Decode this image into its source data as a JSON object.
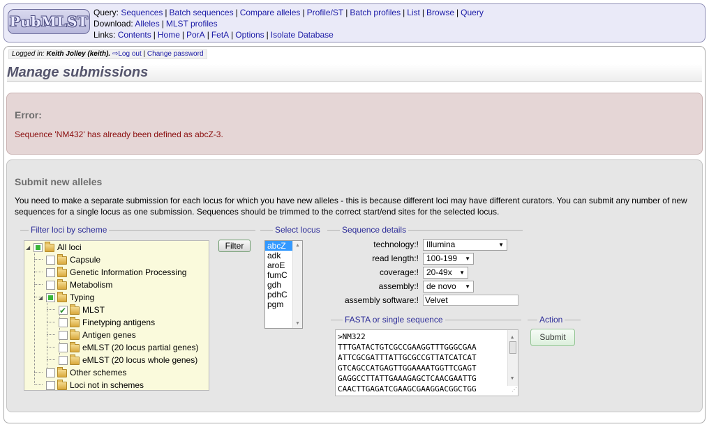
{
  "logo": {
    "text": "PubMLST"
  },
  "nav": {
    "query_label": "Query:",
    "query_links": [
      "Sequences",
      "Batch sequences",
      "Compare alleles",
      "Profile/ST",
      "Batch profiles",
      "List",
      "Browse",
      "Query"
    ],
    "download_label": "Download:",
    "download_links": [
      "Alleles",
      "MLST profiles"
    ],
    "links_label": "Links:",
    "links_links": [
      "Contents",
      "Home",
      "PorA",
      "FetA",
      "Options",
      "Isolate Database"
    ]
  },
  "login": {
    "logged_in_label": "Logged in:",
    "user": "Keith Jolley (keith).",
    "logout": "Log out",
    "separator": "|",
    "change_password": "Change password"
  },
  "page_title": "Manage submissions",
  "error": {
    "title": "Error:",
    "message": "Sequence 'NM432' has already been defined as abcZ-3."
  },
  "submit": {
    "title": "Submit new alleles",
    "intro": "You need to make a separate submission for each locus for which you have new alleles - this is because different loci may have different curators. You can submit any number of new sequences for a single locus as one submission. Sequences should be trimmed to the correct start/end sites for the selected locus.",
    "filter_legend": "Filter loci by scheme",
    "filter_button": "Filter",
    "tree": {
      "all_loci": "All loci",
      "capsule": "Capsule",
      "genetic": "Genetic Information Processing",
      "metabolism": "Metabolism",
      "typing": "Typing",
      "mlst": "MLST",
      "finetyping": "Finetyping antigens",
      "antigen": "Antigen genes",
      "emlst_partial": "eMLST (20 locus partial genes)",
      "emlst_whole": "eMLST (20 locus whole genes)",
      "other": "Other schemes",
      "not_in": "Loci not in schemes"
    },
    "locus_legend": "Select locus",
    "loci": [
      "abcZ",
      "adk",
      "aroE",
      "fumC",
      "gdh",
      "pdhC",
      "pgm"
    ],
    "selected_locus": "abcZ",
    "details_legend": "Sequence details",
    "details": {
      "technology_label": "technology:!",
      "technology_value": "Illumina",
      "read_length_label": "read length:!",
      "read_length_value": "100-199",
      "coverage_label": "coverage:!",
      "coverage_value": "20-49x",
      "assembly_label": "assembly:!",
      "assembly_value": "de novo",
      "software_label": "assembly software:!",
      "software_value": "Velvet"
    },
    "fasta_legend": "FASTA or single sequence",
    "fasta_lines": [
      ">NM322",
      "TTTGATACTGTCGCCGAAGGTTTGGGCGAA",
      "ATTCGCGATTTATTGCGCCGTTATCATCAT",
      "GTCAGCCATGAGTTGGAAAATGGTTCGAGT",
      "GAGGCCTTATTGAAAGAGCTCAACGAATTG",
      "CAACTTGAGATCGAAGCGAAGGACGGCTGG"
    ],
    "action_legend": "Action",
    "submit_button": "Submit"
  }
}
